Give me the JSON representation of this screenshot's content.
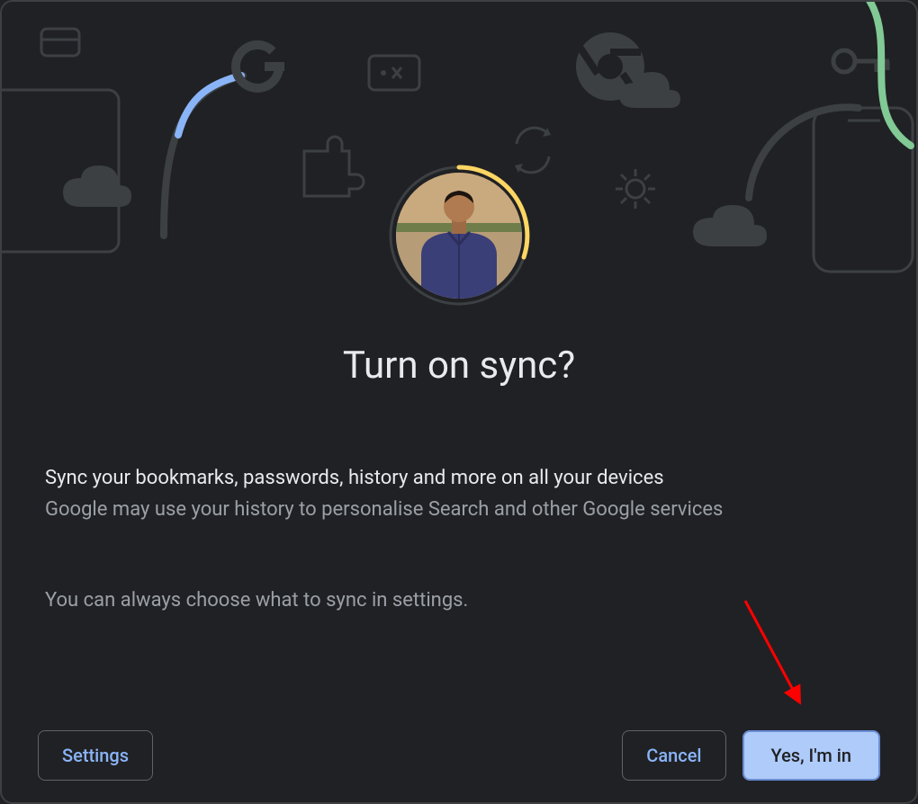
{
  "title": "Turn on sync?",
  "body": {
    "primary": "Sync your bookmarks, passwords, history and more on all your devices",
    "secondary": "Google may use your history to personalise Search and other Google services",
    "tertiary": "You can always choose what to sync in settings."
  },
  "buttons": {
    "settings": "Settings",
    "cancel": "Cancel",
    "confirm": "Yes, I'm in"
  },
  "colors": {
    "accent_blue": "#8ab4f8",
    "accent_green": "#81c995",
    "accent_yellow": "#fdd663",
    "muted": "#9aa0a6",
    "outline": "#5f6368",
    "primary_button_bg": "#aecbfa"
  }
}
